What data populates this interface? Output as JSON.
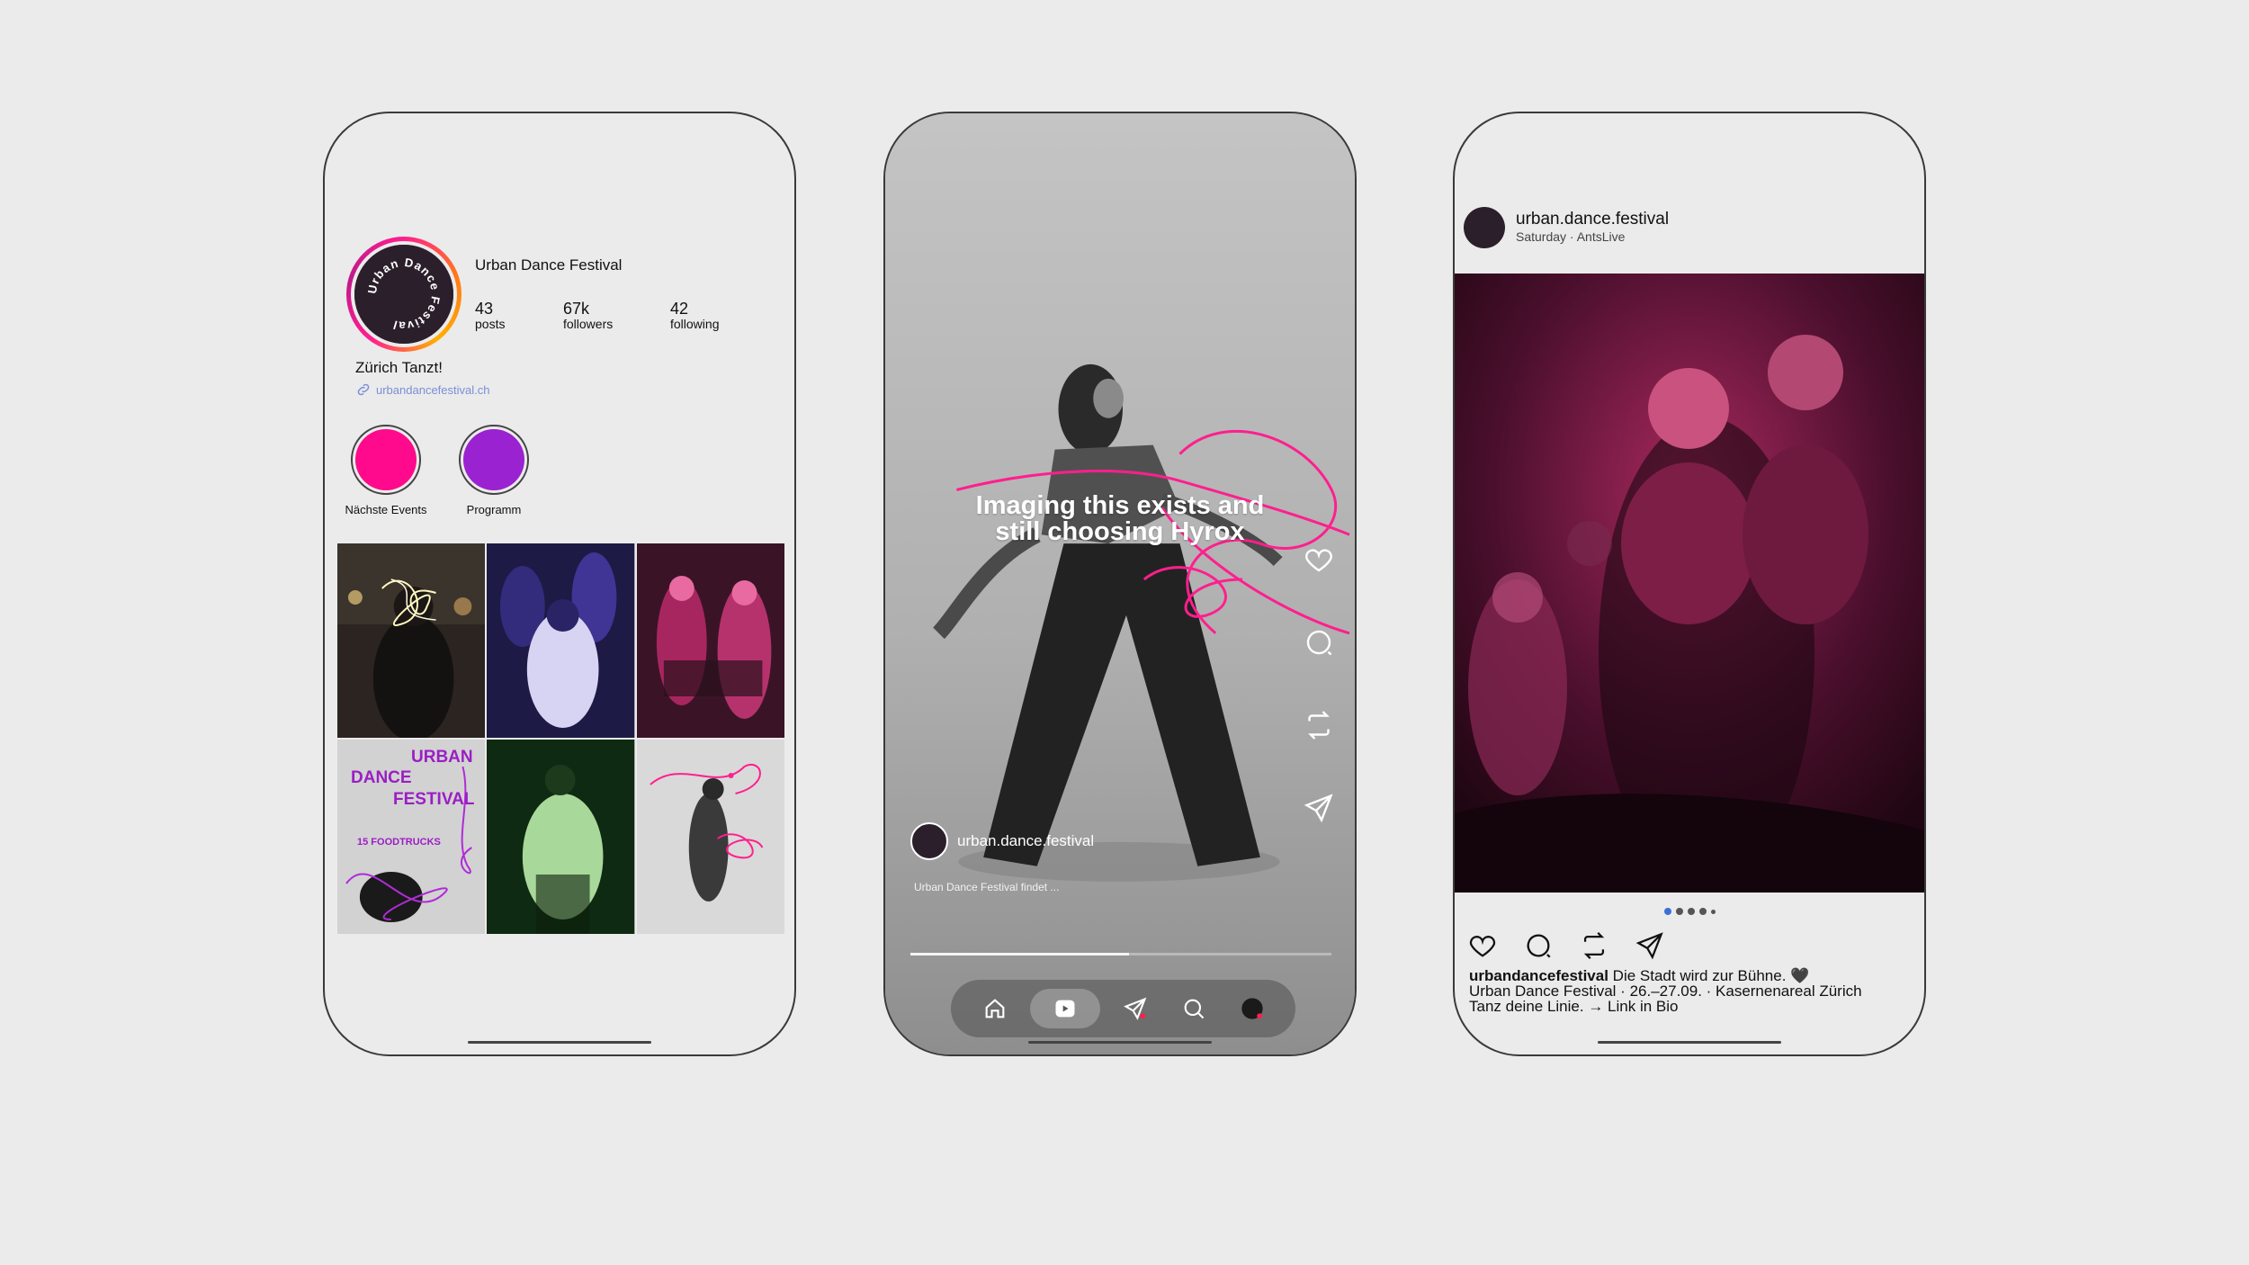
{
  "profile": {
    "name": "Urban Dance Festival",
    "avatar_text": "Urban Dance Festival",
    "stats": [
      {
        "num": "43",
        "label": "posts"
      },
      {
        "num": "67k",
        "label": "followers"
      },
      {
        "num": "42",
        "label": "following"
      }
    ],
    "bio_title": "Zürich Tanzt!",
    "bio_link": "urbandancefestival.ch",
    "highlights": [
      {
        "label": "Nächste Events",
        "color": "#ff0a8c"
      },
      {
        "label": "Programm",
        "color": "#9a22d0"
      }
    ],
    "grid_poster": {
      "line1": "URBAN",
      "line2": "DANCE",
      "line3": "FESTIVAL",
      "small": "15 FOODTRUCKS"
    }
  },
  "reel": {
    "caption_line1": "Imaging this exists and",
    "caption_line2": "still choosing Hyrox",
    "username": "urban.dance.festival",
    "description": "Urban Dance Festival findet ...",
    "progress": 0.52,
    "actions": [
      "heart-icon",
      "comment-icon",
      "repost-icon",
      "send-icon"
    ],
    "nav": [
      "home-icon",
      "reels-icon",
      "explore-icon",
      "search-icon",
      "profile-icon"
    ]
  },
  "post": {
    "username": "urban.dance.festival",
    "subtitle": "Saturday · AntsLive",
    "caption_user": "urbandancefestival",
    "caption_text": " Die Stadt wird zur Bühne. 🖤",
    "caption_line2": "Urban Dance Festival · 26.–27.09. · Kasernenareal Zürich",
    "caption_line3": "Tanz deine Linie. → Link in Bio",
    "carousel_count": 5,
    "carousel_active": 1
  },
  "colors": {
    "accent_pink": "#ff1f8e",
    "accent_purple": "#9a22d0",
    "background": "#ebebeb"
  }
}
